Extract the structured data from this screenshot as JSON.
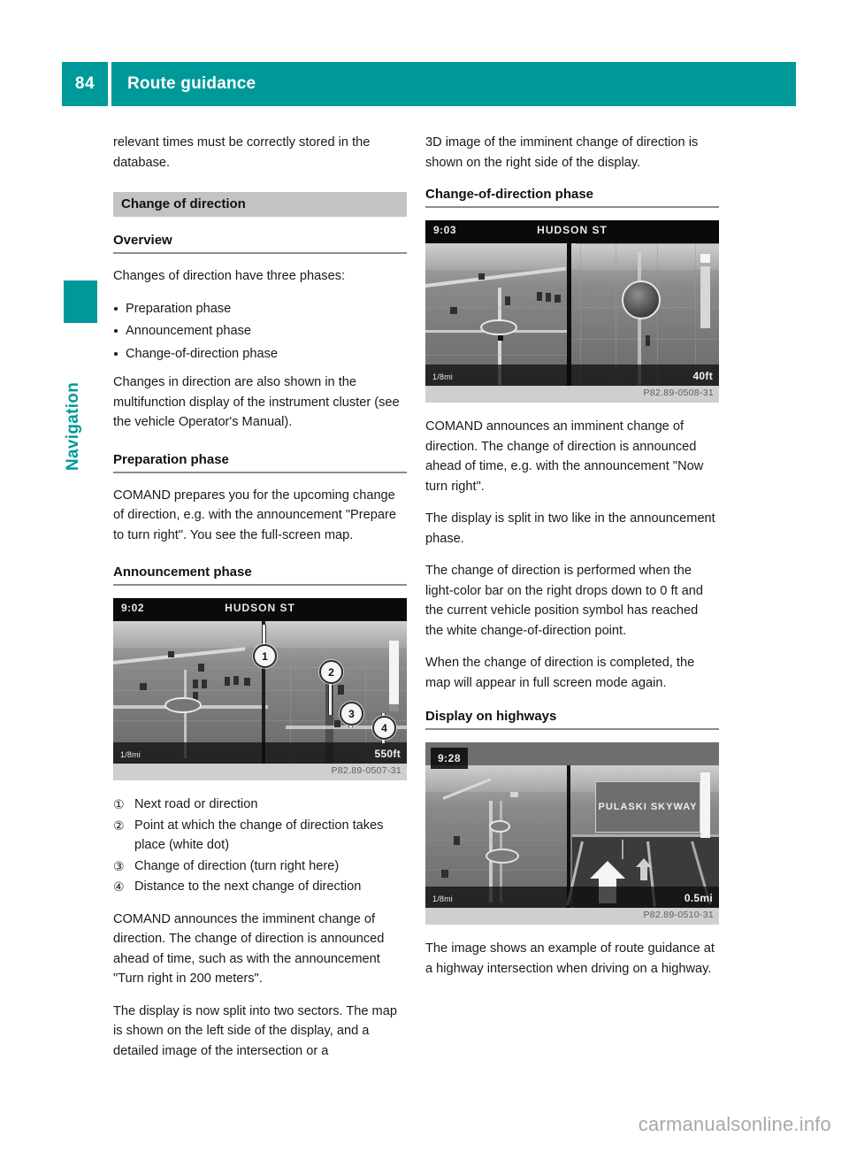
{
  "header": {
    "page_number": "84",
    "title": "Route guidance"
  },
  "chapter": {
    "label": "Navigation"
  },
  "left_column": {
    "intro_paragraph": "relevant times must be correctly stored in the database.",
    "section_banner": "Change of direction",
    "overview_heading": "Overview",
    "overview_intro": "Changes of direction have three phases:",
    "phase_bullets": [
      "Preparation phase",
      "Announcement phase",
      "Change-of-direction phase"
    ],
    "overview_note": "Changes in direction are also shown in the multifunction display of the instrument cluster (see the vehicle Operator's Manual).",
    "preparation_heading": "Preparation phase",
    "preparation_text": "COMAND prepares you for the upcoming change of direction, e.g. with the announcement \"Prepare to turn right\". You see the full-screen map.",
    "announcement_heading": "Announcement phase",
    "figure_announcement": {
      "time": "9:02",
      "road_name": "HUDSON ST",
      "distance": "550ft",
      "scale": "1/8mi",
      "callouts": [
        "1",
        "2",
        "3",
        "4"
      ],
      "credit": "P82.89-0507-31"
    },
    "legend": [
      {
        "num": "①",
        "text": "Next road or direction"
      },
      {
        "num": "②",
        "text": "Point at which the change of direction takes place (white dot)"
      },
      {
        "num": "③",
        "text": "Change of direction (turn right here)"
      },
      {
        "num": "④",
        "text": "Distance to the next change of direction"
      }
    ],
    "announce_text_1": "COMAND announces the imminent change of direction. The change of direction is announced ahead of time, such as with the announcement \"Turn right in 200 meters\".",
    "announce_text_2": "The display is now split into two sectors. The map is shown on the left side of the display, and a detailed image of the intersection or a"
  },
  "right_column": {
    "continuation_text": "3D image of the imminent change of direction is shown on the right side of the display.",
    "change_heading": "Change-of-direction phase",
    "figure_change": {
      "time": "9:03",
      "road_name": "HUDSON ST",
      "distance": "40ft",
      "scale": "1/8mi",
      "credit": "P82.89-0508-31"
    },
    "change_text_1": "COMAND announces an imminent change of direction. The change of direction is announced ahead of time, e.g. with the announcement \"Now turn right\".",
    "change_text_2": "The display is split in two like in the announcement phase.",
    "change_text_3": "The change of direction is performed when the light-color bar on the right drops down to 0 ft and the current vehicle position symbol has reached the white change-of-direction point.",
    "change_text_4": "When the change of direction is completed, the map will appear in full screen mode again.",
    "highway_heading": "Display on highways",
    "figure_highway": {
      "time": "9:28",
      "sign_text": "PULASKI SKYWAY",
      "distance": "0.5mi",
      "scale": "1/8mi",
      "credit": "P82.89-0510-31"
    },
    "highway_text": "The image shows an example of route guidance at a highway intersection when driving on a highway."
  },
  "footer": {
    "watermark": "carmanualsonline.info"
  },
  "colors": {
    "accent_teal": "#009999",
    "banner_gray": "#c3c3c3",
    "rule_gray": "#8c8c8c",
    "watermark_gray": "#a8a8a8"
  }
}
